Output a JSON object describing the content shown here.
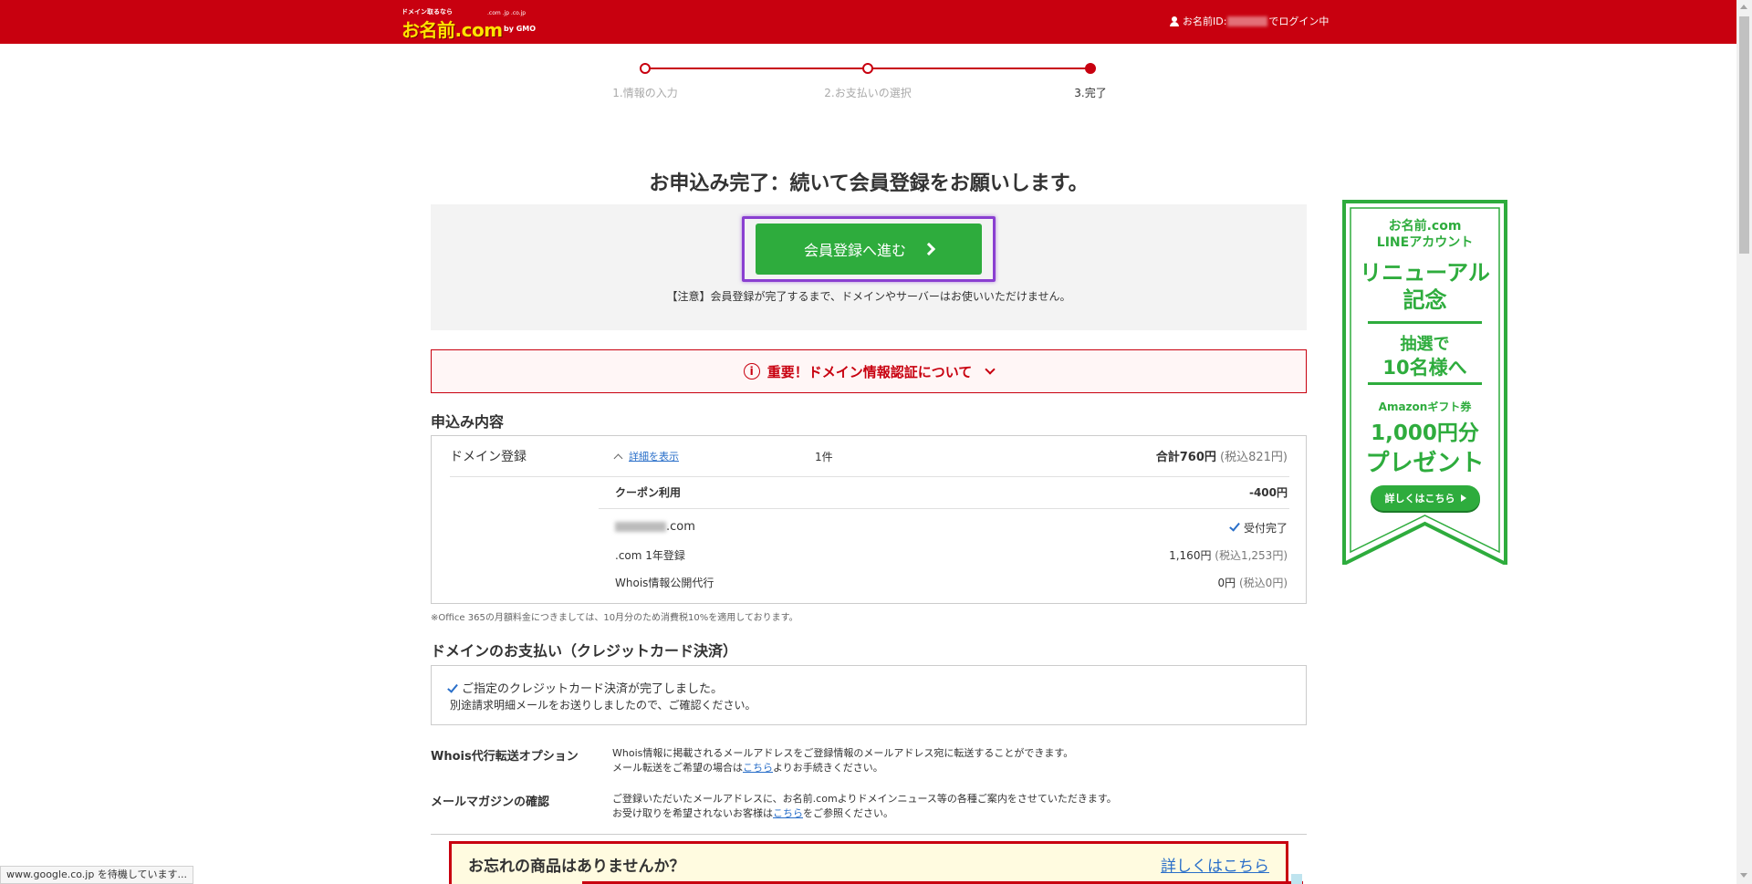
{
  "header": {
    "logo_tagline": "ドメイン取るなら",
    "logo_text": "お名前.com",
    "logo_sub": ".com .jp .co.jp",
    "logo_gmo": "by GMO",
    "login_prefix": "お名前ID:",
    "login_suffix": "でログイン中"
  },
  "steps": [
    {
      "label": "1.情報の入力",
      "active": false
    },
    {
      "label": "2.お支払いの選択",
      "active": false
    },
    {
      "label": "3.完了",
      "active": true
    }
  ],
  "main": {
    "title": "お申込み完了：続いて会員登録をお願いします。",
    "cta_label": "会員登録へ進む",
    "cta_note": "【注意】会員登録が完了するまで、ドメインやサーバーはお使いいただけません。",
    "alert_label": "重要！ドメイン情報認証について",
    "alert_icon_glyph": "i"
  },
  "order": {
    "heading": "申込み内容",
    "service": "ドメイン登録",
    "detail_link": "詳細を表示",
    "count": "1件",
    "total_label": "合計760円",
    "total_tax": "(税込821円)",
    "coupon_label": "クーポン利用",
    "coupon_value": "-400円",
    "domain_suffix": ".com",
    "status": "受付完了",
    "item1_label": ".com 1年登録",
    "item1_price": "1,160円",
    "item1_tax": "(税込1,253円)",
    "item2_label": "Whois情報公開代行",
    "item2_price": "0円",
    "item2_tax": "(税込0円)",
    "footnote": "※Office 365の月額料金につきましては、10月分のため消費税10%を適用しております。"
  },
  "payment": {
    "heading": "ドメインのお支払い（クレジットカード決済）",
    "line1": "ご指定のクレジットカード決済が完了しました。",
    "line2": "別途請求明細メールをお送りしましたので、ご確認ください。"
  },
  "options": [
    {
      "label": "Whois代行転送オプション",
      "line1": "Whois情報に掲載されるメールアドレスをご登録情報のメールアドレス宛に転送することができます。",
      "line2_pre": "メール転送をご希望の場合は",
      "link": "こちら",
      "line2_post": "よりお手続きください。"
    },
    {
      "label": "メールマガジンの確認",
      "line1": "ご登録いただいたメールアドレスに、お名前.comよりドメインニュース等の各種ご案内をさせていただきます。",
      "line2_pre": "お受け取りを希望されないお客様は",
      "link": "こちら",
      "line2_post": "をご参照ください。"
    }
  ],
  "promo": {
    "title": "お忘れの商品はありませんか？",
    "link": "詳しくはこちら"
  },
  "banner": {
    "brand": "お名前.com",
    "account": "LINEアカウント",
    "renewal": "リニューアル",
    "kinen": "記念",
    "lottery": "抽選で",
    "winners": "10名様へ",
    "gift": "Amazonギフト券",
    "amount": "1,000円分",
    "present": "プレゼント",
    "button": "詳しくはこちら"
  },
  "statusbar": "www.google.co.jp を待機しています...",
  "colors": {
    "brand_red": "#c8000f",
    "cta_green": "#2eac3d",
    "highlight_purple": "#8a3fd1",
    "link_blue": "#2a6fc9"
  }
}
